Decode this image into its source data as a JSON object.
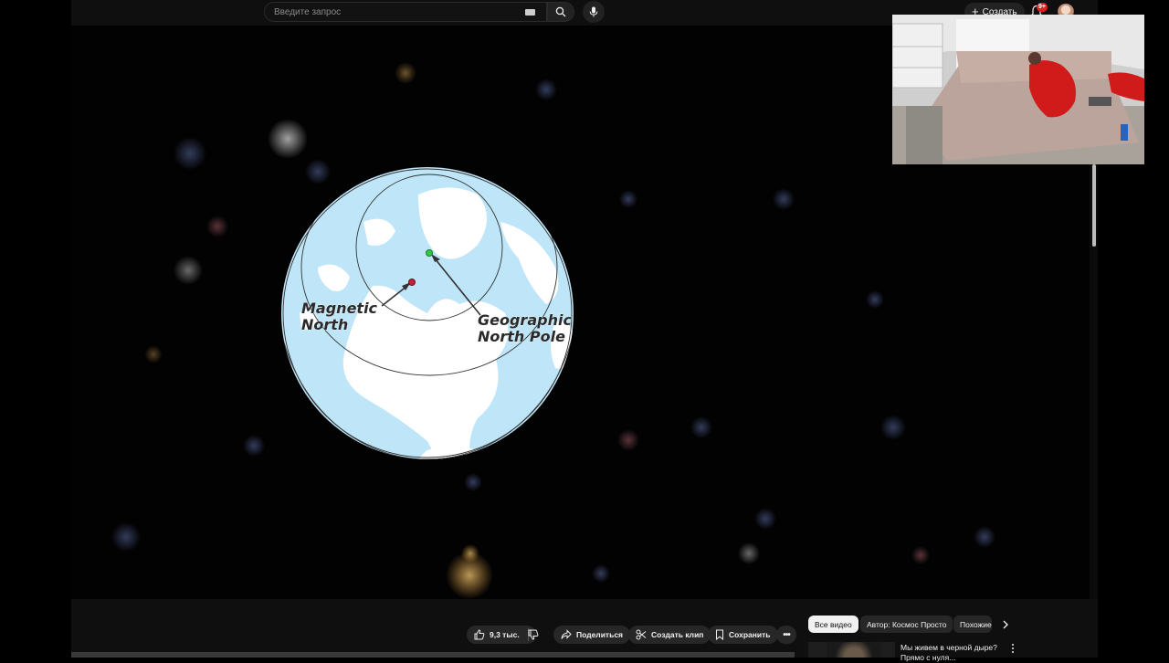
{
  "topbar": {
    "search_placeholder": "Введите запрос",
    "create_label": "Создать",
    "notifications_badge": "9+"
  },
  "video": {
    "label_magnetic_north": [
      "Magnetic",
      "North"
    ],
    "label_geographic_north": [
      "Geographic",
      "North Pole"
    ]
  },
  "actions": {
    "likes": "9,3 тыс.",
    "share": "Поделиться",
    "clip": "Создать клип",
    "save": "Сохранить"
  },
  "chips": {
    "items": [
      "Все видео",
      "Автор: Космос Просто",
      "Похожие"
    ]
  },
  "recommendation": {
    "title": "Мы живем в черной дыре? Прямо с нуля..."
  },
  "colors": {
    "geographic_pole": "#2ecc40",
    "magnetic_pole": "#c0243a",
    "ocean": "#bfe6f8",
    "land": "#ffffff"
  }
}
